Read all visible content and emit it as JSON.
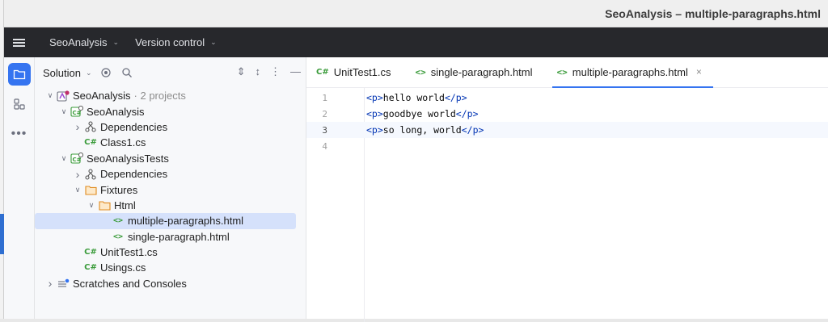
{
  "window": {
    "title": "SeoAnalysis – multiple-paragraphs.html"
  },
  "toolbar": {
    "project": "SeoAnalysis",
    "vcs": "Version control"
  },
  "strip": {
    "icons": [
      "folder-icon",
      "structure-icon",
      "more-icon"
    ]
  },
  "solution": {
    "title": "Solution",
    "tree": [
      {
        "label": "SeoAnalysis",
        "suffix": "· 2 projects",
        "icon": "solution-icon",
        "depth": 0,
        "arrow": "expanded"
      },
      {
        "label": "SeoAnalysis",
        "icon": "csharp-project-icon",
        "depth": 1,
        "arrow": "expanded"
      },
      {
        "label": "Dependencies",
        "icon": "dependencies-icon",
        "depth": 2,
        "arrow": "collapsed"
      },
      {
        "label": "Class1.cs",
        "icon": "csharp-file-icon",
        "depth": 2,
        "arrow": "none"
      },
      {
        "label": "SeoAnalysisTests",
        "icon": "csharp-project-icon",
        "depth": 1,
        "arrow": "expanded"
      },
      {
        "label": "Dependencies",
        "icon": "dependencies-icon",
        "depth": 2,
        "arrow": "collapsed"
      },
      {
        "label": "Fixtures",
        "icon": "folder-icon",
        "depth": 2,
        "arrow": "expanded"
      },
      {
        "label": "Html",
        "icon": "folder-icon",
        "depth": 3,
        "arrow": "expanded"
      },
      {
        "label": "multiple-paragraphs.html",
        "icon": "html-file-icon",
        "depth": 4,
        "arrow": "none",
        "selected": true
      },
      {
        "label": "single-paragraph.html",
        "icon": "html-file-icon",
        "depth": 4,
        "arrow": "none"
      },
      {
        "label": "UnitTest1.cs",
        "icon": "csharp-file-icon",
        "depth": 2,
        "arrow": "none"
      },
      {
        "label": "Usings.cs",
        "icon": "csharp-file-icon",
        "depth": 2,
        "arrow": "none"
      },
      {
        "label": "Scratches and Consoles",
        "icon": "scratches-icon",
        "depth": 0,
        "arrow": "collapsed"
      }
    ]
  },
  "tabs": [
    {
      "label": "UnitTest1.cs",
      "icon": "csharp-file-icon",
      "active": false
    },
    {
      "label": "single-paragraph.html",
      "icon": "html-file-icon",
      "active": false
    },
    {
      "label": "multiple-paragraphs.html",
      "icon": "html-file-icon",
      "active": true
    }
  ],
  "editor": {
    "current_line": 3,
    "lines": [
      {
        "num": "1",
        "open": "<p>",
        "text": "hello world",
        "close": "</p>"
      },
      {
        "num": "2",
        "open": "<p>",
        "text": "goodbye world",
        "close": "</p>"
      },
      {
        "num": "3",
        "open": "<p>",
        "text": "so long, world",
        "close": "</p>"
      },
      {
        "num": "4",
        "open": "",
        "text": "",
        "close": ""
      }
    ]
  },
  "glyphs": {
    "csharp": "C#",
    "html": "<>"
  },
  "colors": {
    "accent": "#3574f0",
    "selection": "#d5e1fb",
    "toolbar_bg": "#27282c",
    "csharp_green": "#3a9b3a",
    "tag_blue": "#0033b3"
  }
}
